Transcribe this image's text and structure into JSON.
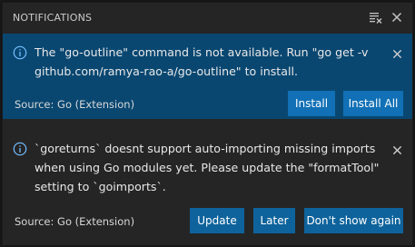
{
  "header": {
    "title": "NOTIFICATIONS",
    "clear_all_icon": "clear-all-icon",
    "close_icon": "close-icon"
  },
  "notifications": [
    {
      "icon": "info-icon",
      "message": "The \"go-outline\" command is not available. Run \"go get -v github.com/ramya-rao-a/go-outline\" to install.",
      "source": "Source: Go (Extension)",
      "buttons": [
        "Install",
        "Install All"
      ],
      "selected": true
    },
    {
      "icon": "info-icon",
      "message": "`goreturns` doesnt support auto-importing missing imports when using Go modules yet. Please update the \"formatTool\" setting to `goimports`.",
      "source": "Source: Go (Extension)",
      "buttons": [
        "Update",
        "Later",
        "Don't show again"
      ],
      "selected": false
    }
  ],
  "colors": {
    "panel_bg": "#252526",
    "selected_bg": "#094771",
    "button_bg": "#0e639c",
    "info_blue": "#75beff",
    "text": "#e8e8e8"
  }
}
